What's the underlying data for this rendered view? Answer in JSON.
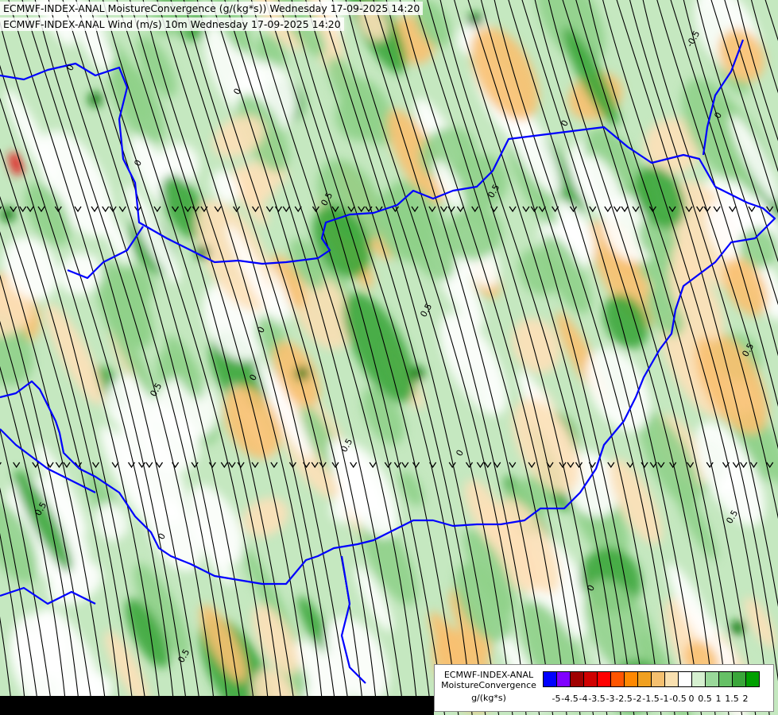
{
  "title_lines": [
    "ECMWF-INDEX-ANAL MoistureConvergence (g/(kg*s)) Wednesday 17-09-2025 14:20",
    "ECMWF-INDEX-ANAL Wind (m/s) 10m Wednesday 17-09-2025 14:20"
  ],
  "legend": {
    "line1": "ECMWF-INDEX-ANAL",
    "line2": "MoistureConvergence",
    "units": "g/(kg*s)",
    "colors": [
      "#0000ff",
      "#8000ff",
      "#a00000",
      "#d00000",
      "#ff0000",
      "#ff5500",
      "#ff8800",
      "#f0a020",
      "#f5c070",
      "#f9e0b0",
      "#ffffff",
      "#d6f0d0",
      "#9ad89a",
      "#66c066",
      "#3aa63a",
      "#00a000"
    ],
    "ticks": [
      "-5",
      "-4.5",
      "-4",
      "-3.5",
      "-3",
      "-2.5",
      "-2",
      "-1.5",
      "-1",
      "-0.5",
      "0",
      "0.5",
      "1",
      "1.5",
      "2"
    ]
  },
  "map": {
    "field_colors": {
      "white": "#ffffff",
      "light_green": "#c5e8c0",
      "mid_green": "#8fd08a",
      "dark_green": "#3aa63a",
      "darkest_green": "#0d7a0d",
      "light_orange": "#fde0b8",
      "orange": "#f8c070",
      "dark_orange": "#f08a20",
      "red": "#e02020"
    },
    "border_color": "#0000ff",
    "streamline_color": "#000000",
    "contour_labels": [
      "0",
      "0",
      "0",
      "0.5",
      "0.5",
      "0.5",
      "0",
      "-0.5",
      "0",
      "0.5",
      "0",
      "0.5",
      "0",
      "0.5",
      "0.5",
      "0",
      "0.5",
      "0",
      "0.5",
      "0"
    ]
  }
}
